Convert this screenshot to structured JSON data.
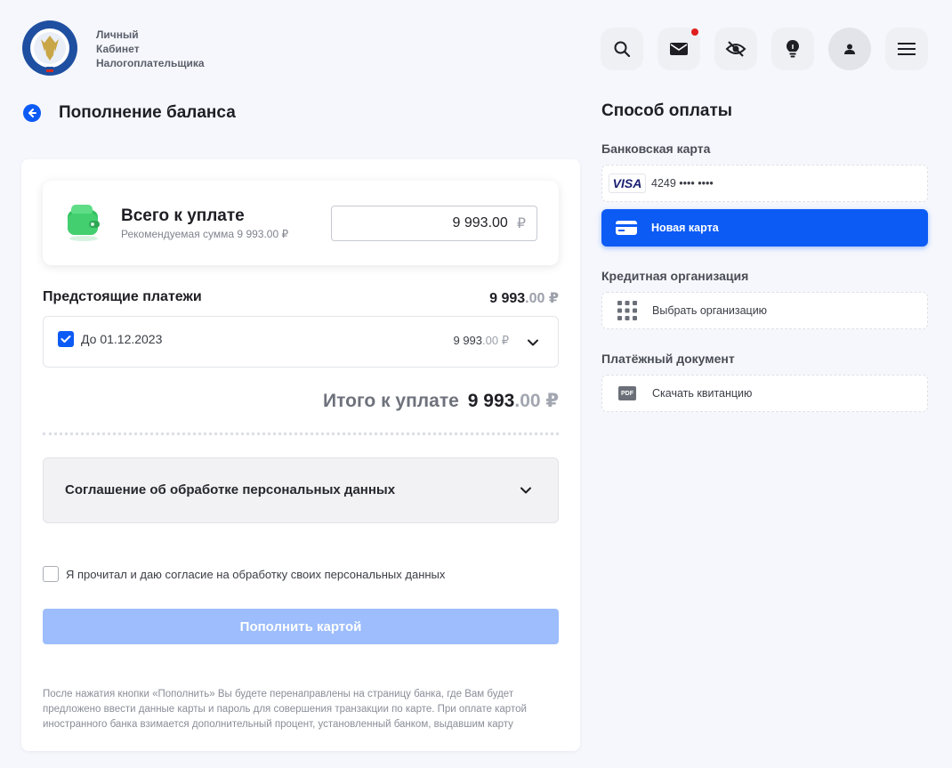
{
  "header": {
    "logo_lines": [
      "Личный",
      "Кабинет",
      "Налогоплательщика"
    ],
    "icons": [
      "search-icon",
      "mail-icon",
      "eye-off-icon",
      "lightbulb-icon",
      "user-icon",
      "menu-icon"
    ]
  },
  "page": {
    "title": "Пополнение баланса"
  },
  "summary": {
    "title": "Всего к уплате",
    "recommended": "Рекомендуемая сумма 9 993.00 ₽",
    "input_value": "9 993.00",
    "currency": "₽"
  },
  "upcoming": {
    "label": "Предстоящие платежи",
    "total_int": "9 993",
    "total_frac": ".00 ₽",
    "items": [
      {
        "date": "До 01.12.2023",
        "amount_int": "9 993",
        "amount_frac": ".00 ₽",
        "checked": true
      }
    ]
  },
  "total": {
    "label": "Итого к уплате",
    "amount_int": "9 993",
    "amount_frac": ".00 ₽"
  },
  "agreement": {
    "title": "Соглашение об обработке персональных данных"
  },
  "consent": {
    "text": "Я прочитал и даю согласие на обработку своих персональных данных",
    "checked": false
  },
  "pay_button": {
    "label": "Пополнить картой"
  },
  "footnote": "После нажатия кнопки «Пополнить» Вы будете перенаправлены на страницу банка, где Вам будет предложено ввести данные карты и пароль для совершения транзакции по карте. При оплате картой иностранного банка взимается дополнительный процент, установленный банком, выдавшим карту",
  "payment_method": {
    "title": "Способ оплаты",
    "bank_card_label": "Банковская карта",
    "saved_card": {
      "brand": "VISA",
      "masked": "4249 •••• ••••"
    },
    "new_card": "Новая карта",
    "credit_org_label": "Кредитная организация",
    "choose_org": "Выбрать организацию",
    "doc_label": "Платёжный документ",
    "download_receipt": "Скачать квитанцию",
    "pdf_badge": "PDF"
  },
  "colors": {
    "accent": "#0d5bf5",
    "accent_disabled": "#9dbdfc",
    "notification": "#e01e1e"
  }
}
